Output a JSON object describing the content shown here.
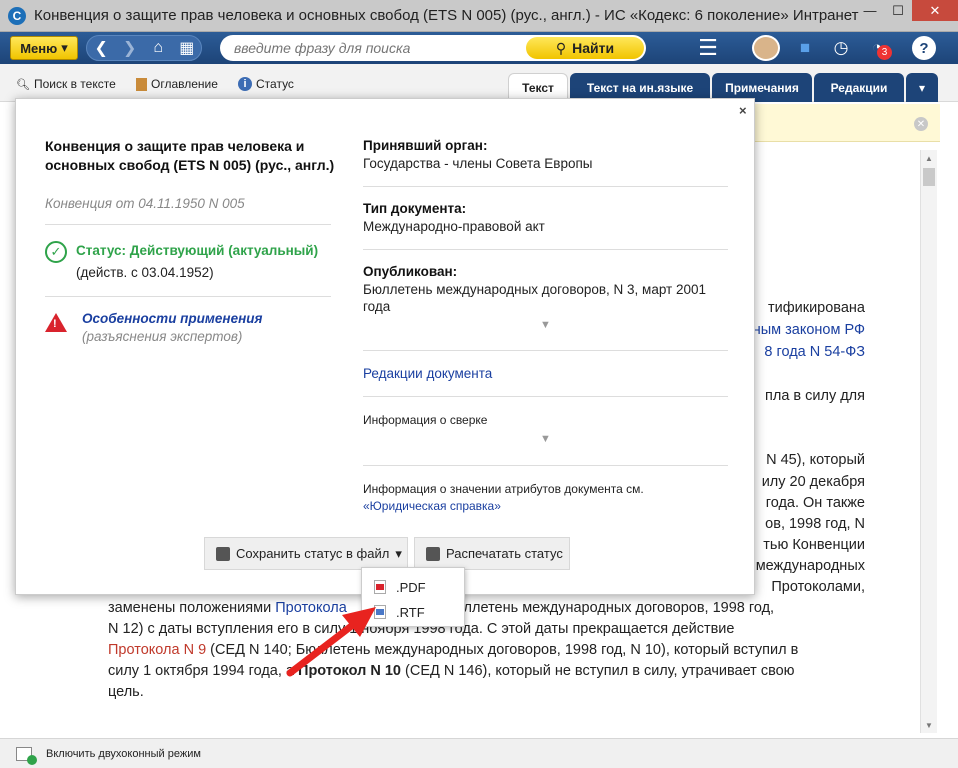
{
  "window": {
    "title": "Конвенция о защите прав человека и основных свобод (ETS N 005) (рус., англ.) - ИС «Кодекс: 6 поколение» Интранет",
    "app_icon": "С",
    "minimize": "—",
    "maximize": "☐",
    "close": "✕"
  },
  "toolbar": {
    "menu_label": "Меню",
    "search_placeholder": "введите фразу для поиска",
    "search_button": "Найти",
    "notification_count": "3",
    "help": "?"
  },
  "subbar": {
    "search_in_text": "Поиск в тексте",
    "contents": "Оглавление",
    "status": "Статус"
  },
  "tabs": [
    {
      "label": "Текст",
      "active": true
    },
    {
      "label": "Текст на ин.языке",
      "active": false
    },
    {
      "label": "Примечания",
      "active": false
    },
    {
      "label": "Редакции",
      "active": false
    },
    {
      "label": "▾",
      "active": false
    }
  ],
  "document": {
    "lines": [
      {
        "parts": [
          {
            "t": "тификирована",
            "c": "plain"
          }
        ]
      },
      {
        "parts": [
          {
            "t": "ным законом РФ",
            "c": "link"
          }
        ]
      },
      {
        "parts": [
          {
            "t": "8 года N 54-ФЗ",
            "c": "link"
          }
        ]
      },
      {
        "parts": [
          {
            "t": "пла в силу для",
            "c": "plain"
          }
        ]
      },
      {
        "parts": [
          {
            "t": "N 45), который",
            "c": "plain"
          }
        ]
      },
      {
        "parts": [
          {
            "t": "илу 20 декабря",
            "c": "plain"
          }
        ]
      },
      {
        "parts": [
          {
            "t": "года. Он также",
            "c": "plain"
          }
        ]
      },
      {
        "parts": [
          {
            "t": "ов, 1998 год, N",
            "c": "plain"
          }
        ]
      },
      {
        "parts": [
          {
            "t": "тью Конвенции",
            "c": "plain"
          }
        ]
      },
      {
        "parts": [
          {
            "t": "международных",
            "c": "plain"
          }
        ]
      },
      {
        "parts": [
          {
            "t": "Протоколами,",
            "c": "plain"
          }
        ]
      },
      {
        "parts": [
          {
            "t": "заменены положениями ",
            "c": "plain"
          },
          {
            "t": "Протокола",
            "c": "link"
          },
          {
            "t": "                155; Бюллетень международных договоров, 1998 год,",
            "c": "plain"
          }
        ]
      },
      {
        "parts": [
          {
            "t": "N 12) с даты вступления его в силу 1 ноября 1998 года. С этой даты прекращается действие",
            "c": "plain"
          }
        ]
      },
      {
        "parts": [
          {
            "t": "Протокола N 9",
            "c": "red"
          },
          {
            "t": " (СЕД N 140; Бюллетень международных договоров, 1998 год, N 10), который вступил в",
            "c": "plain"
          }
        ]
      },
      {
        "parts": [
          {
            "t": "силу 1 октября 1994 года, а ",
            "c": "plain"
          },
          {
            "t": "Протокол N 10",
            "c": "bold"
          },
          {
            "t": " (СЕД N 146), который не вступил в силу, утрачивает свою",
            "c": "plain"
          }
        ]
      },
      {
        "parts": [
          {
            "t": "цель.",
            "c": "plain"
          }
        ]
      }
    ]
  },
  "statusbar": {
    "dual_window_mode": "Включить двухоконный режим"
  },
  "modal": {
    "close": "×",
    "doc_title": "Конвенция о защите прав человека и основных свобод (ETS N 005) (рус., англ.)",
    "doc_subtitle": "Конвенция от 04.11.1950 N 005",
    "status_label": "Статус: Действующий (актуальный)",
    "status_date": "(действ. с 03.04.1952)",
    "features_link": "Особенности применения",
    "features_sub": "(разъяснения экспертов)",
    "adopted_by_label": "Принявший орган:",
    "adopted_by_value": "Государства - члены Совета Европы",
    "doc_type_label": "Тип документа:",
    "doc_type_value": "Международно-правовой акт",
    "published_label": "Опубликован:",
    "published_value": "Бюллетень международных договоров, N 3, март 2001 года",
    "expand_arrow": "▼",
    "editions_link": "Редакции документа",
    "reconciliation_info": "Информация о сверке",
    "attributes_info": "Информация о значении атрибутов документа см.",
    "legal_reference_link": "«Юридическая справка»",
    "save_status_button": "Сохранить статус в файл",
    "print_status_button": "Распечатать статус"
  },
  "save_menu": {
    "items": [
      ".PDF",
      ".RTF"
    ]
  },
  "colors": {
    "toolbar_blue": "#1d4478",
    "accent_yellow": "#f1c400",
    "status_green": "#2fa34a",
    "warning_red": "#d9232d",
    "link_blue": "#1a3fa0"
  }
}
